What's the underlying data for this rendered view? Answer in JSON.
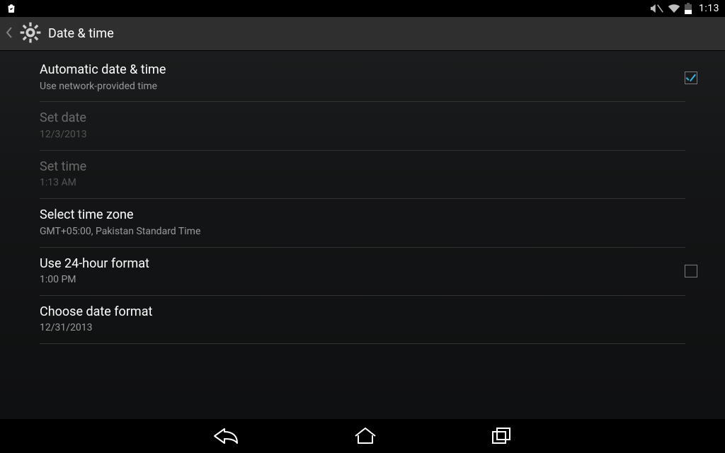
{
  "statusbar": {
    "time": "1:13",
    "icons": {
      "shopping": "shopping",
      "vibrate": "vibrate",
      "wifi": "wifi",
      "battery": "battery"
    }
  },
  "actionbar": {
    "title": "Date & time",
    "icon": "settings-gear"
  },
  "settings": [
    {
      "key": "auto_datetime",
      "title": "Automatic date & time",
      "subtitle": "Use network-provided time",
      "enabled": true,
      "control": "checkbox",
      "checked": true
    },
    {
      "key": "set_date",
      "title": "Set date",
      "subtitle": "12/3/2013",
      "enabled": false,
      "control": "none"
    },
    {
      "key": "set_time",
      "title": "Set time",
      "subtitle": "1:13 AM",
      "enabled": false,
      "control": "none"
    },
    {
      "key": "timezone",
      "title": "Select time zone",
      "subtitle": "GMT+05:00, Pakistan Standard Time",
      "enabled": true,
      "control": "none"
    },
    {
      "key": "24h",
      "title": "Use 24-hour format",
      "subtitle": "1:00 PM",
      "enabled": true,
      "control": "checkbox",
      "checked": false
    },
    {
      "key": "date_format",
      "title": "Choose date format",
      "subtitle": "12/31/2013",
      "enabled": true,
      "control": "none"
    }
  ],
  "navbar": {
    "back": "back",
    "home": "home",
    "recent": "recent"
  }
}
